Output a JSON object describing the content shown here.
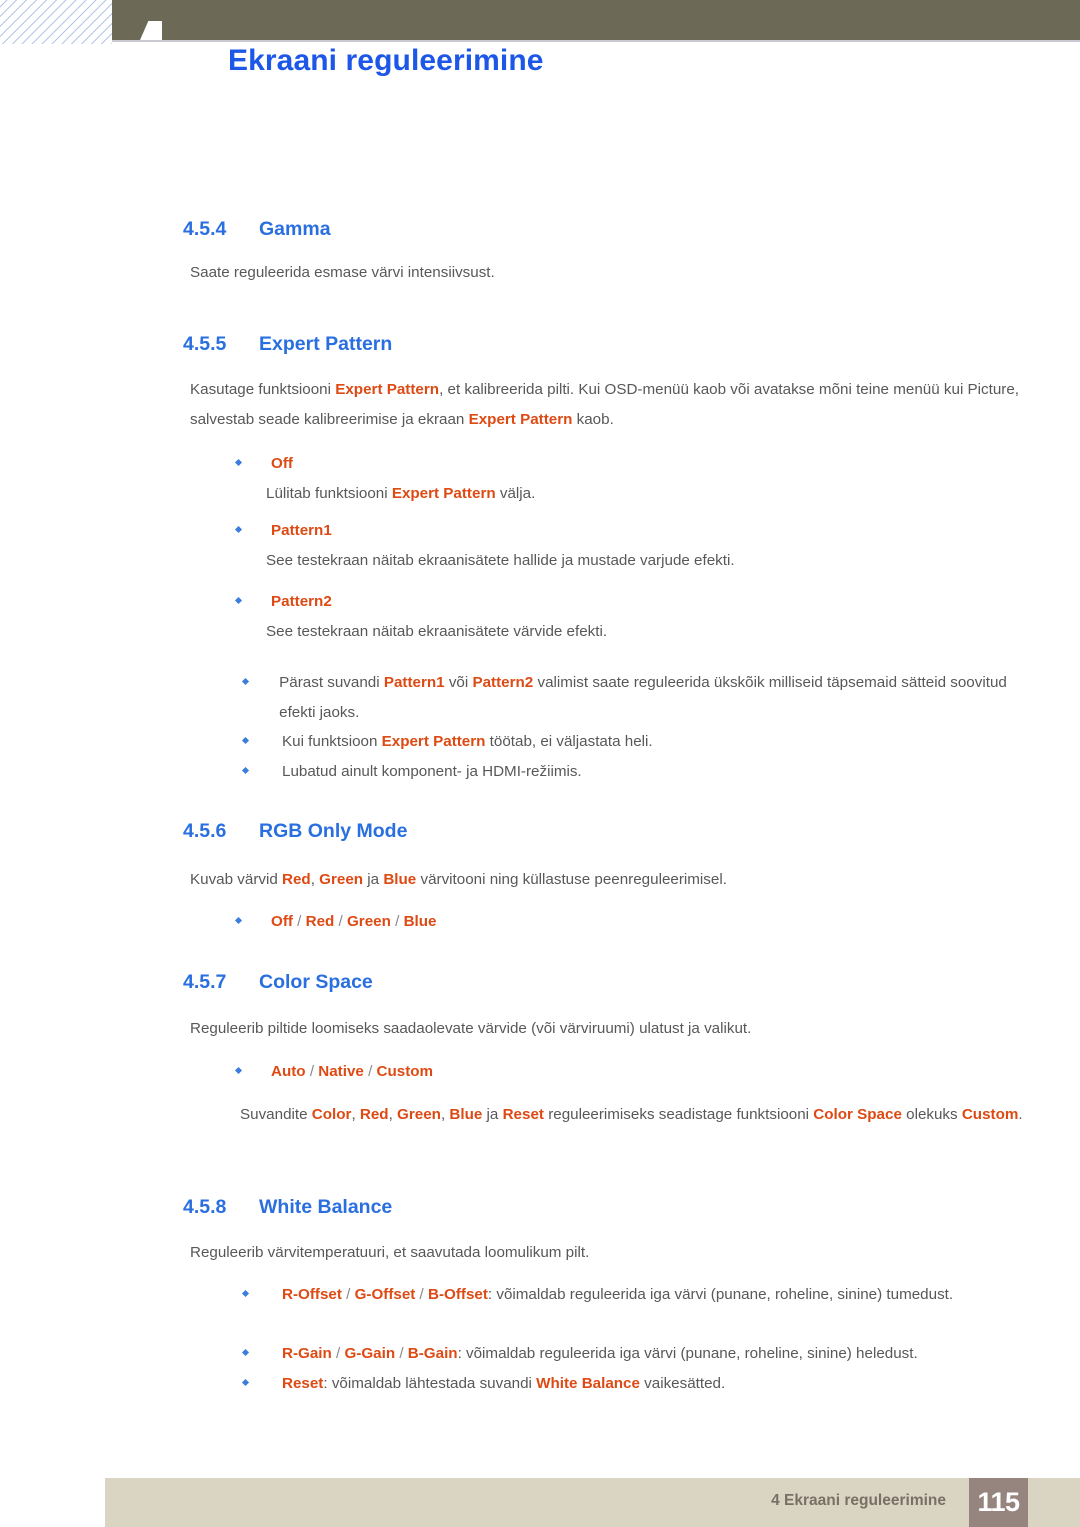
{
  "header": {
    "chapter_number": "4",
    "title": "Ekraani reguleerimine"
  },
  "footer": {
    "label": "4 Ekraani reguleerimine",
    "page_number": "115"
  },
  "colors": {
    "heading_blue": "#2a6fe0",
    "title_blue": "#1c57e8",
    "highlight_orange": "#dd4a14",
    "body_gray": "#585858",
    "olive_bar": "#6c6a56",
    "footer_band": "#dad5c2",
    "page_badge": "#96857f"
  },
  "sections": [
    {
      "number": "4.5.4",
      "title": "Gamma",
      "intro": "Saate reguleerida esmase värvi intensiivsust."
    },
    {
      "number": "4.5.5",
      "title": "Expert Pattern",
      "intro_1a": "Kasutage funktsiooni ",
      "intro_1b": "Expert Pattern",
      "intro_1c": ", et kalibreerida pilti. Kui OSD-menüü kaob või avatakse mõni teine",
      "intro_2a": "menüü kui Picture, salvestab seade kalibreerimise ja ekraan ",
      "intro_2b": "Expert Pattern",
      "intro_2c": " kaob.",
      "options": [
        {
          "label": "Off",
          "desc_a": "Lülitab funktsiooni ",
          "desc_b": "Expert Pattern",
          "desc_c": " välja."
        },
        {
          "label": "Pattern1",
          "desc_a": "See testekraan näitab ekraanisätete hallide ja mustade varjude efekti.",
          "desc_b": "",
          "desc_c": ""
        },
        {
          "label": "Pattern2",
          "desc_a": "See testekraan näitab ekraanisätete värvide efekti.",
          "desc_b": "",
          "desc_c": ""
        }
      ],
      "notes": [
        {
          "t1": "Pärast suvandi ",
          "h1": "Pattern1",
          "t2": " või ",
          "h2": "Pattern2",
          "t3": " valimist saate reguleerida ükskõik milliseid täpsemaid sätteid",
          "t4": "soovitud efekti jaoks."
        },
        {
          "t1": "Kui funktsioon ",
          "h1": "Expert Pattern",
          "t2": " töötab, ei väljastata heli.",
          "h2": "",
          "t3": "",
          "t4": ""
        },
        {
          "t1": "Lubatud ainult komponent- ja HDMI-režiimis.",
          "h1": "",
          "t2": "",
          "h2": "",
          "t3": "",
          "t4": ""
        }
      ]
    },
    {
      "number": "4.5.6",
      "title": "RGB Only Mode",
      "intro_a": "Kuvab värvid ",
      "intro_h1": "Red",
      "intro_b": ", ",
      "intro_h2": "Green",
      "intro_c": " ja ",
      "intro_h3": "Blue",
      "intro_d": " värvitooni ning küllastuse peenreguleerimisel.",
      "options_line": [
        "Off",
        "Red",
        "Green",
        "Blue"
      ]
    },
    {
      "number": "4.5.7",
      "title": "Color Space",
      "intro": "Reguleerib piltide loomiseks saadaolevate värvide (või värviruumi) ulatust ja valikut.",
      "options_line": [
        "Auto",
        "Native",
        "Custom"
      ],
      "note_a": "Suvandite ",
      "note_h1": "Color",
      "note_b": ", ",
      "note_h2": "Red",
      "note_c": ", ",
      "note_h3": "Green",
      "note_d": ", ",
      "note_h4": "Blue",
      "note_e": " ja ",
      "note_h5": "Reset",
      "note_f": " reguleerimiseks seadistage funktsiooni ",
      "note_h6": "Color Space",
      "note_g": "olekuks ",
      "note_h7": "Custom",
      "note_h": "."
    },
    {
      "number": "4.5.8",
      "title": "White Balance",
      "intro": "Reguleerib värvitemperatuuri, et saavutada loomulikum pilt.",
      "items": [
        {
          "h1": "R-Offset",
          "h2": "G-Offset",
          "h3": "B-Offset",
          "t1": ": võimaldab reguleerida iga värvi (punane, roheline, sinine)",
          "t2": "tumedust."
        },
        {
          "h1": "R-Gain",
          "h2": "G-Gain",
          "h3": "B-Gain",
          "t1": ": võimaldab reguleerida iga värvi (punane, roheline, sinine) heledust.",
          "t2": ""
        }
      ],
      "reset_h": "Reset",
      "reset_t1": ": võimaldab lähtestada suvandi ",
      "reset_h2": "White Balance",
      "reset_t2": " vaikesätted."
    }
  ]
}
